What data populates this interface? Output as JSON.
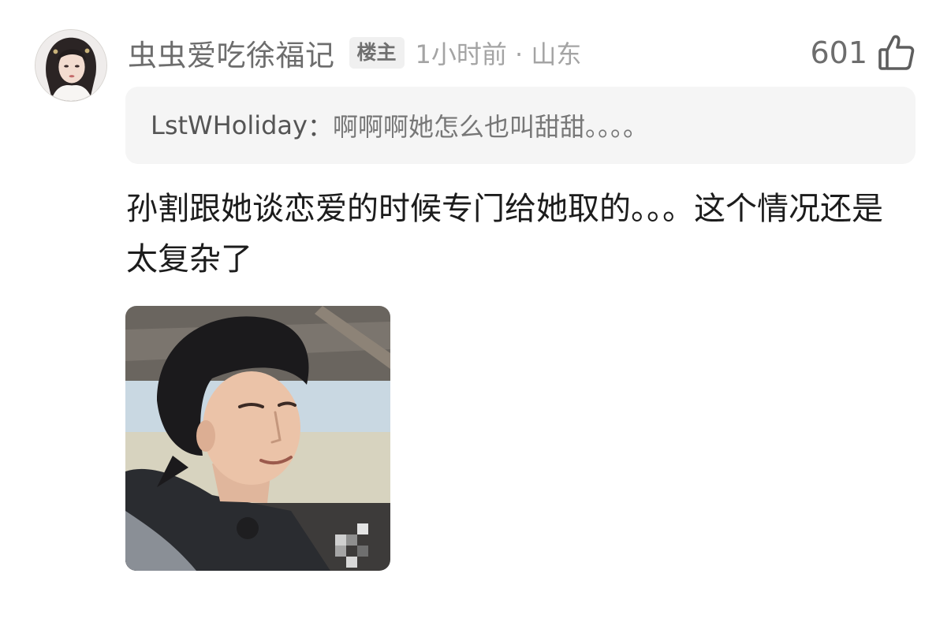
{
  "comment": {
    "username": "虫虫爱吃徐福记",
    "badge": "楼主",
    "meta": "1小时前 · 山东",
    "like_count": "601",
    "quote": {
      "author": "LstWHoliday",
      "separator": "：",
      "text": "啊啊啊她怎么也叫甜甜。。。。"
    },
    "body": "孙割跟她谈恋爱的时候专门给她取的。。。这个情况还是太复杂了"
  },
  "icons": {
    "like": "thumbs-up-icon",
    "avatar": "avatar-image",
    "attachment": "reaction-photo"
  },
  "colors": {
    "username": "#6d6d6d",
    "meta": "#a4a4a4",
    "quote_bg": "#f5f5f5",
    "badge_bg": "#f0f0f0",
    "body_text": "#1c1c1c"
  }
}
